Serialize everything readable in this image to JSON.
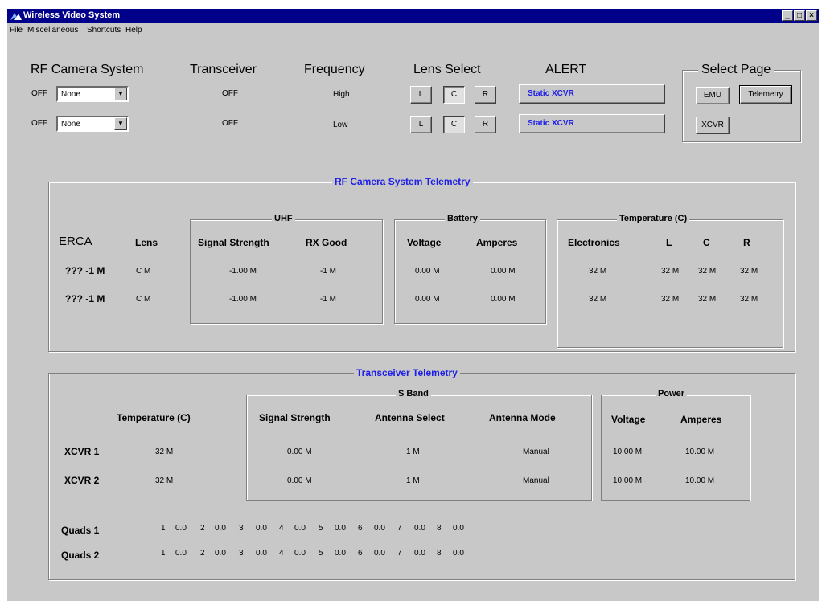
{
  "window": {
    "title": "Wireless Video System",
    "buttons": [
      "_",
      "□",
      "×"
    ]
  },
  "menu": [
    "File",
    "Miscellaneous",
    "Shortcuts",
    "Help"
  ],
  "top": {
    "headers": {
      "rf_camera": "RF Camera System",
      "transceiver": "Transceiver",
      "frequency": "Frequency",
      "lens_select": "Lens Select",
      "alert": "ALERT",
      "select_page": "Select Page"
    },
    "rows": [
      {
        "state": "OFF",
        "camera": "None",
        "xcvr": "OFF",
        "freq": "High",
        "lens": [
          "L",
          "C",
          "R"
        ],
        "alert": "Static XCVR"
      },
      {
        "state": "OFF",
        "camera": "None",
        "xcvr": "OFF",
        "freq": "Low",
        "lens": [
          "L",
          "C",
          "R"
        ],
        "alert": "Static XCVR"
      }
    ],
    "pages": {
      "emu": "EMU",
      "telemetry": "Telemetry",
      "xcvr": "XCVR"
    }
  },
  "rf_telemetry": {
    "title": "RF Camera System Telemetry",
    "uhf": "UHF",
    "battery": "Battery",
    "temperature": "Temperature  (C)",
    "cols": {
      "erca": "ERCA",
      "lens": "Lens",
      "signal": "Signal Strength",
      "rx": "RX Good",
      "voltage": "Voltage",
      "amperes": "Amperes",
      "electronics": "Electronics",
      "l": "L",
      "c": "C",
      "r": "R"
    },
    "rows": [
      {
        "erca": "??? -1 M",
        "lens": "C M",
        "signal": "-1.00 M",
        "rx": "-1 M",
        "voltage": "0.00 M",
        "amperes": "0.00 M",
        "electronics": "32 M",
        "l": "32 M",
        "c": "32 M",
        "r": "32 M"
      },
      {
        "erca": "??? -1 M",
        "lens": "C M",
        "signal": "-1.00 M",
        "rx": "-1 M",
        "voltage": "0.00 M",
        "amperes": "0.00 M",
        "electronics": "32 M",
        "l": "32 M",
        "c": "32 M",
        "r": "32 M"
      }
    ]
  },
  "xcvr_telemetry": {
    "title": "Transceiver Telemetry",
    "sband": "S Band",
    "power": "Power",
    "cols": {
      "temp": "Temperature  (C)",
      "signal": "Signal Strength",
      "antenna_select": "Antenna Select",
      "antenna_mode": "Antenna Mode",
      "voltage": "Voltage",
      "amperes": "Amperes"
    },
    "rows": [
      {
        "name": "XCVR 1",
        "temp": "32 M",
        "signal": "0.00 M",
        "antenna_select": "1 M",
        "antenna_mode": "Manual",
        "voltage": "10.00 M",
        "amperes": "10.00 M"
      },
      {
        "name": "XCVR 2",
        "temp": "32 M",
        "signal": "0.00 M",
        "antenna_select": "1 M",
        "antenna_mode": "Manual",
        "voltage": "10.00 M",
        "amperes": "10.00 M"
      }
    ],
    "quads": [
      {
        "label": "Quads 1",
        "cells": [
          "1",
          "0.0",
          "2",
          "0.0",
          "3",
          "0.0",
          "4",
          "0.0",
          "5",
          "0.0",
          "6",
          "0.0",
          "7",
          "0.0",
          "8",
          "0.0"
        ]
      },
      {
        "label": "Quads 2",
        "cells": [
          "1",
          "0.0",
          "2",
          "0.0",
          "3",
          "0.0",
          "4",
          "0.0",
          "5",
          "0.0",
          "6",
          "0.0",
          "7",
          "0.0",
          "8",
          "0.0"
        ]
      }
    ]
  }
}
